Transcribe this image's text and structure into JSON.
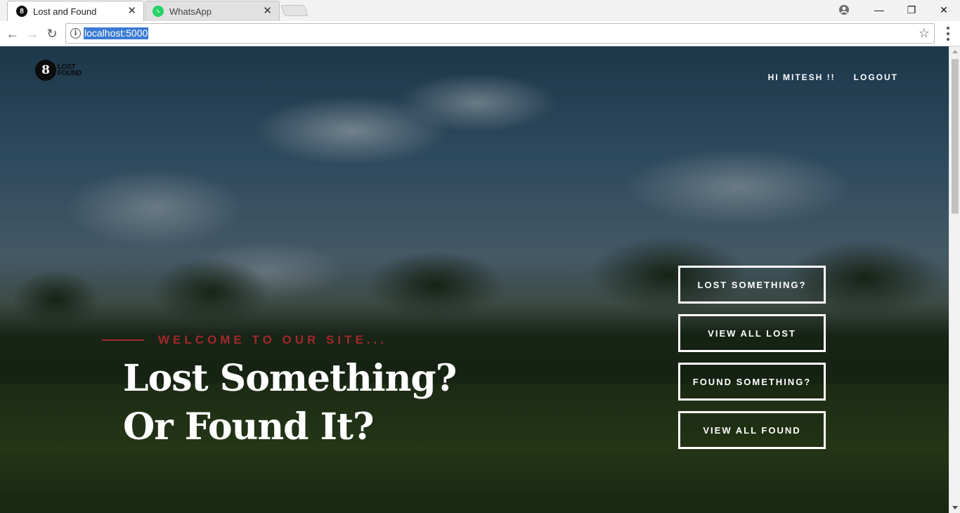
{
  "browser": {
    "tabs": [
      {
        "title": "Lost and Found",
        "active": true,
        "favicon": "lost-found-logo-icon"
      },
      {
        "title": "WhatsApp",
        "active": false,
        "favicon": "whatsapp-icon"
      }
    ],
    "close_glyph": "✕",
    "address": "localhost:5000",
    "window_controls": {
      "minimize": "—",
      "restore": "❐",
      "close": "✕"
    }
  },
  "site": {
    "logo": {
      "mark": "8",
      "line1": "LOST",
      "line2": "FOUND"
    },
    "nav": {
      "greeting": "HI MITESH !!",
      "logout": "LOGOUT"
    },
    "hero": {
      "welcome": "WELCOME TO OUR SITE...",
      "headline_line1": "Lost Something?",
      "headline_line2": "Or Found It?"
    },
    "actions": [
      {
        "label": "LOST SOMETHING?"
      },
      {
        "label": "VIEW ALL LOST"
      },
      {
        "label": "FOUND SOMETHING?"
      },
      {
        "label": "VIEW ALL FOUND"
      }
    ]
  },
  "colors": {
    "accent": "#a3282c",
    "url_highlight": "#3a7bd5"
  }
}
